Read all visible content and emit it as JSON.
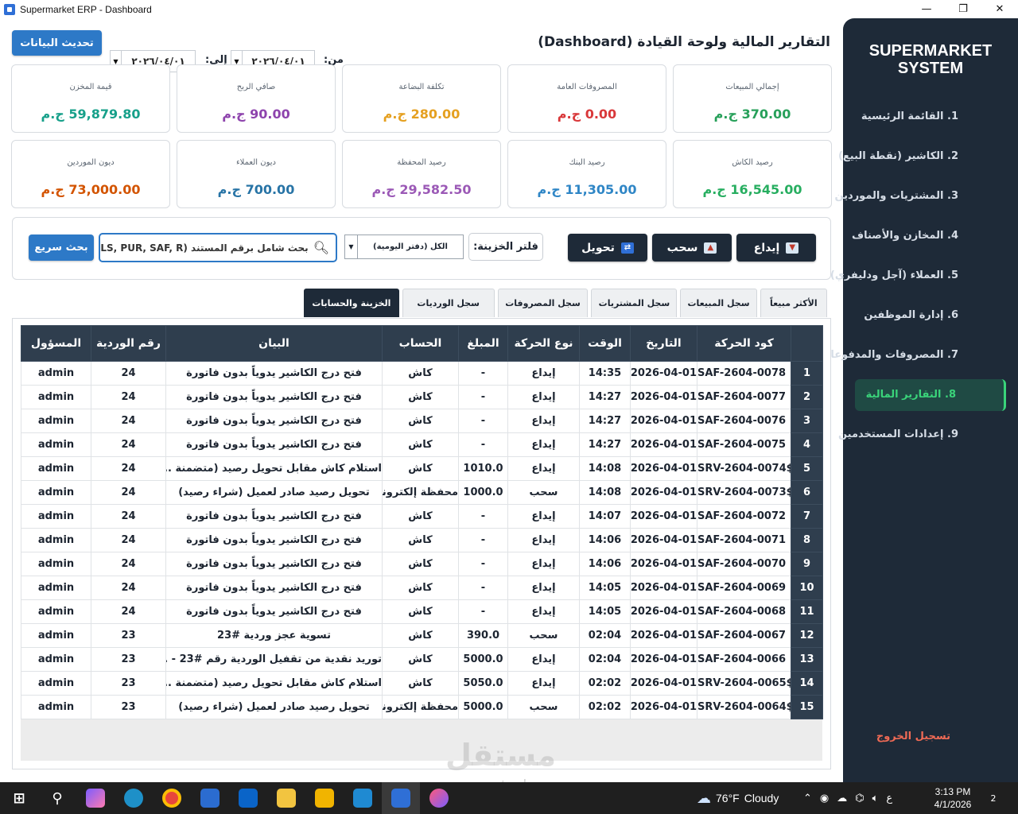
{
  "window": {
    "title": "Supermarket ERP - Dashboard",
    "minimize": "—",
    "maximize": "❐",
    "close": "✕"
  },
  "sidebar": {
    "brand_line1": "SUPERMARKET",
    "brand_line2": "SYSTEM",
    "items": [
      {
        "label": "1. القائمة الرئيسية"
      },
      {
        "label": "2. الكاشير (نقطة البيع)"
      },
      {
        "label": "3. المشتريات والموردين"
      },
      {
        "label": "4. المخازن والأصناف"
      },
      {
        "label": "5. العملاء (آجل ودليفري)"
      },
      {
        "label": "6. إدارة الموظفين"
      },
      {
        "label": "7. المصروفات والمدفوعات"
      },
      {
        "label": "8. التقارير المالية"
      },
      {
        "label": "9. إعدادات المستخدمين"
      }
    ],
    "active_index": 7,
    "logout": "تسجيل الخروج"
  },
  "header": {
    "title": "التقارير المالية ولوحة القيادة (Dashboard)",
    "from_label": "من:",
    "to_label": "إلى:",
    "from_date": "٢٠٢٦/٠٤/٠١",
    "to_date": "٢٠٢٦/٠٤/٠١",
    "refresh_label": "تحديث البيانات"
  },
  "cards": [
    {
      "label": "إجمالي المبيعات",
      "value": "370.00 ج.م",
      "color": "#27a05a"
    },
    {
      "label": "المصروفات العامة",
      "value": "0.00 ج.م",
      "color": "#d9383a"
    },
    {
      "label": "تكلفة البضاعة",
      "value": "280.00 ج.م",
      "color": "#e5a020"
    },
    {
      "label": "صافي الربح",
      "value": "90.00 ج.م",
      "color": "#8e44ad"
    },
    {
      "label": "قيمة المخزن",
      "value": "59,879.80 ج.م",
      "color": "#17a08a"
    },
    {
      "label": "رصيد الكاش",
      "value": "16,545.00 ج.م",
      "color": "#27ae60"
    },
    {
      "label": "رصيد البنك",
      "value": "11,305.00 ج.م",
      "color": "#2f86c6"
    },
    {
      "label": "رصيد المحفظة",
      "value": "29,582.50 ج.م",
      "color": "#9b59b6"
    },
    {
      "label": "ديون العملاء",
      "value": "700.00 ج.م",
      "color": "#2874a6"
    },
    {
      "label": "ديون الموردين",
      "value": "73,000.00 ج.م",
      "color": "#d35400"
    }
  ],
  "filters": {
    "deposit": "إيداع",
    "withdraw": "سحب",
    "transfer": "تحويل",
    "treasury_label": "فلتر الخزينة:",
    "treasury_value": "الكل (دفتر اليومية)",
    "search_placeholder": "بحث شامل برقم المستند (SLS, PUR, SAF, R...",
    "quick_search": "بحث سريع"
  },
  "tabs": [
    {
      "label": "الأكثر مبيعاً",
      "width": 86
    },
    {
      "label": "سجل المبيعات",
      "width": 98
    },
    {
      "label": "سجل المشتريات",
      "width": 110
    },
    {
      "label": "سجل المصروفات",
      "width": 116
    },
    {
      "label": "سجل الورديات",
      "width": 118
    },
    {
      "label": "الخزينة والحسابات",
      "width": 122
    }
  ],
  "active_tab": 5,
  "table": {
    "columns": [
      "كود الحركة",
      "التاريخ",
      "الوقت",
      "نوع الحركة",
      "المبلغ",
      "الحساب",
      "البيان",
      "رقم الوردية",
      "المسؤول"
    ],
    "rows": [
      [
        "1",
        "SAF-2604-0078",
        "2026-04-01",
        "14:35",
        "إيداع",
        "-",
        "كاش",
        "فتح درج الكاشير يدوياً بدون فاتورة",
        "24",
        "admin"
      ],
      [
        "2",
        "SAF-2604-0077",
        "2026-04-01",
        "14:27",
        "إيداع",
        "-",
        "كاش",
        "فتح درج الكاشير يدوياً بدون فاتورة",
        "24",
        "admin"
      ],
      [
        "3",
        "SAF-2604-0076",
        "2026-04-01",
        "14:27",
        "إيداع",
        "-",
        "كاش",
        "فتح درج الكاشير يدوياً بدون فاتورة",
        "24",
        "admin"
      ],
      [
        "4",
        "SAF-2604-0075",
        "2026-04-01",
        "14:27",
        "إيداع",
        "-",
        "كاش",
        "فتح درج الكاشير يدوياً بدون فاتورة",
        "24",
        "admin"
      ],
      [
        "5",
        "SRV-2604-0074$",
        "2026-04-01",
        "14:08",
        "إيداع",
        "1010.0",
        "كاش",
        "استلام كاش مقابل تحويل رصيد (متضمنة ...",
        "24",
        "admin"
      ],
      [
        "6",
        "SRV-2604-0073$",
        "2026-04-01",
        "14:08",
        "سحب",
        "1000.0",
        "محفظة إلكترونية",
        "تحويل رصيد صادر لعميل (شراء رصيد)",
        "24",
        "admin"
      ],
      [
        "7",
        "SAF-2604-0072",
        "2026-04-01",
        "14:07",
        "إيداع",
        "-",
        "كاش",
        "فتح درج الكاشير يدوياً بدون فاتورة",
        "24",
        "admin"
      ],
      [
        "8",
        "SAF-2604-0071",
        "2026-04-01",
        "14:06",
        "إيداع",
        "-",
        "كاش",
        "فتح درج الكاشير يدوياً بدون فاتورة",
        "24",
        "admin"
      ],
      [
        "9",
        "SAF-2604-0070",
        "2026-04-01",
        "14:06",
        "إيداع",
        "-",
        "كاش",
        "فتح درج الكاشير يدوياً بدون فاتورة",
        "24",
        "admin"
      ],
      [
        "10",
        "SAF-2604-0069",
        "2026-04-01",
        "14:05",
        "إيداع",
        "-",
        "كاش",
        "فتح درج الكاشير يدوياً بدون فاتورة",
        "24",
        "admin"
      ],
      [
        "11",
        "SAF-2604-0068",
        "2026-04-01",
        "14:05",
        "إيداع",
        "-",
        "كاش",
        "فتح درج الكاشير يدوياً بدون فاتورة",
        "24",
        "admin"
      ],
      [
        "12",
        "SAF-2604-0067",
        "2026-04-01",
        "02:04",
        "سحب",
        "390.0",
        "كاش",
        "تسوية عجز وردية #23",
        "23",
        "admin"
      ],
      [
        "13",
        "SAF-2604-0066",
        "2026-04-01",
        "02:04",
        "إيداع",
        "5000.0",
        "كاش",
        "توريد نقدية من تقفيل الوردية رقم #23 - ...",
        "23",
        "admin"
      ],
      [
        "14",
        "SRV-2604-0065$",
        "2026-04-01",
        "02:02",
        "إيداع",
        "5050.0",
        "كاش",
        "استلام كاش مقابل تحويل رصيد (متضمنة ...",
        "23",
        "admin"
      ],
      [
        "15",
        "SRV-2604-0064$",
        "2026-04-01",
        "02:02",
        "سحب",
        "5000.0",
        "محفظة إلكترونية",
        "تحويل رصيد صادر لعميل (شراء رصيد)",
        "23",
        "admin"
      ]
    ]
  },
  "taskbar": {
    "temperature": "76°F",
    "weather": "Cloudy",
    "lang": "ع",
    "time": "3:13 PM",
    "date": "4/1/2026",
    "notifications": "2"
  },
  "watermark": {
    "text": "مستقل",
    "sub": "mostaql.com"
  }
}
